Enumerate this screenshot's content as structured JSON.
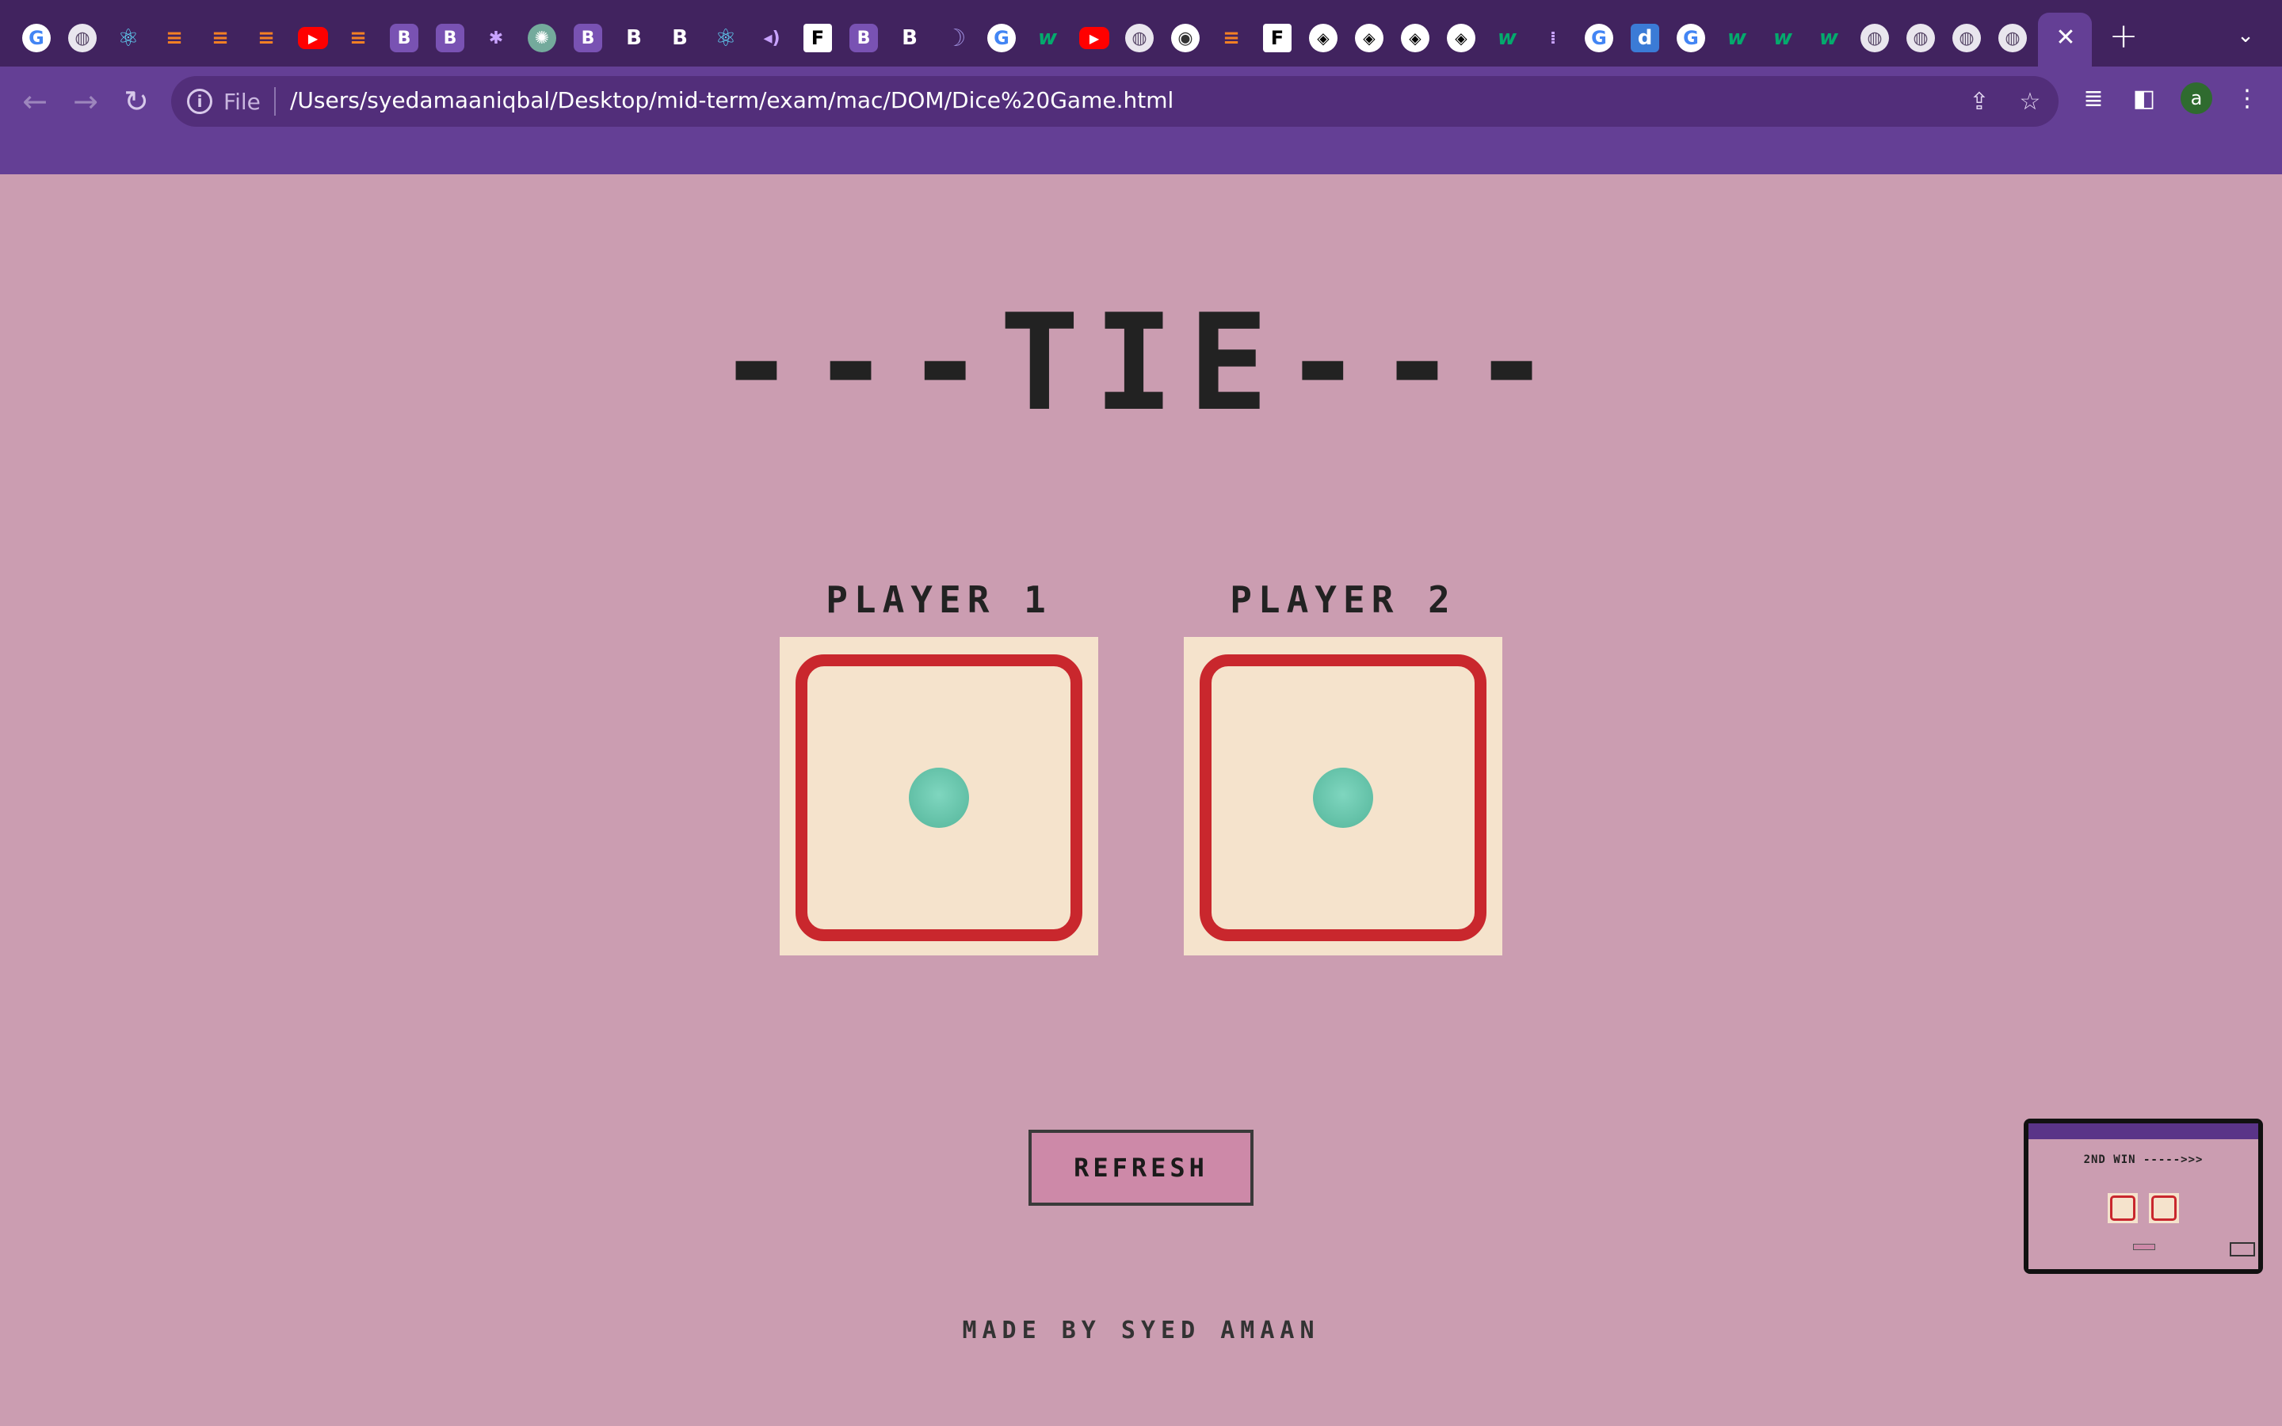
{
  "browser": {
    "tabs": [
      {
        "icon": "google-icon",
        "glyph": "G"
      },
      {
        "icon": "globe-icon",
        "glyph": "◍"
      },
      {
        "icon": "react-icon",
        "glyph": "⚛"
      },
      {
        "icon": "stackoverflow-icon",
        "glyph": "≡"
      },
      {
        "icon": "stackoverflow-icon",
        "glyph": "≡"
      },
      {
        "icon": "stackoverflow-icon",
        "glyph": "≡"
      },
      {
        "icon": "youtube-icon",
        "glyph": "▶"
      },
      {
        "icon": "stackoverflow-icon",
        "glyph": "≡"
      },
      {
        "icon": "behance-icon",
        "glyph": "B"
      },
      {
        "icon": "behance-icon",
        "glyph": "B"
      },
      {
        "icon": "misc-icon",
        "glyph": "✱"
      },
      {
        "icon": "chatgpt-icon",
        "glyph": "✺"
      },
      {
        "icon": "bootstrap-icon",
        "glyph": "B"
      },
      {
        "icon": "bootstrap-dark-icon",
        "glyph": "B"
      },
      {
        "icon": "bootstrap-dark-icon",
        "glyph": "B"
      },
      {
        "icon": "react-icon",
        "glyph": "⚛"
      },
      {
        "icon": "audio-icon",
        "glyph": "◂)"
      },
      {
        "icon": "frontendmentor-icon",
        "glyph": "F"
      },
      {
        "icon": "bootstrap-icon",
        "glyph": "B"
      },
      {
        "icon": "bootstrap-dark-icon",
        "glyph": "B"
      },
      {
        "icon": "moon-icon",
        "glyph": "☽"
      },
      {
        "icon": "google-icon",
        "glyph": "G"
      },
      {
        "icon": "w3schools-icon",
        "glyph": "w"
      },
      {
        "icon": "youtube-icon",
        "glyph": "▶"
      },
      {
        "icon": "globe-icon",
        "glyph": "◍"
      },
      {
        "icon": "chrome-icon",
        "glyph": "◉"
      },
      {
        "icon": "stackoverflow-icon",
        "glyph": "≡"
      },
      {
        "icon": "frontendmentor-icon",
        "glyph": "F"
      },
      {
        "icon": "codepen-icon",
        "glyph": "◈"
      },
      {
        "icon": "codepen-icon",
        "glyph": "◈"
      },
      {
        "icon": "codepen-icon",
        "glyph": "◈"
      },
      {
        "icon": "codepen-icon",
        "glyph": "◈"
      },
      {
        "icon": "w3schools-icon",
        "glyph": "w"
      },
      {
        "icon": "misc-icon",
        "glyph": "⁞"
      },
      {
        "icon": "google-icon",
        "glyph": "G"
      },
      {
        "icon": "dev-icon",
        "glyph": "d"
      },
      {
        "icon": "google-icon",
        "glyph": "G"
      },
      {
        "icon": "w3schools-icon",
        "glyph": "w"
      },
      {
        "icon": "w3schools-icon",
        "glyph": "w"
      },
      {
        "icon": "w3schools-icon",
        "glyph": "w"
      },
      {
        "icon": "globe-icon",
        "glyph": "◍"
      },
      {
        "icon": "globe-icon",
        "glyph": "◍"
      },
      {
        "icon": "globe-icon",
        "glyph": "◍"
      },
      {
        "icon": "globe-icon",
        "glyph": "◍"
      }
    ],
    "address_scheme": "File",
    "url": "/Users/syedamaaniqbal/Desktop/mid-term/exam/mac/DOM/Dice%20Game.html",
    "profile_initial": "a"
  },
  "page": {
    "headline": "---TIE---",
    "players": [
      {
        "label": "PLAYER 1",
        "die_value": 1
      },
      {
        "label": "PLAYER 2",
        "die_value": 1
      }
    ],
    "refresh_label": "REFRESH",
    "credit": "MADE BY SYED AMAAN"
  },
  "thumbnail": {
    "title": "2ND WIN ----->>>"
  },
  "colors": {
    "tabstrip": "#41235f",
    "toolbar": "#643f95",
    "page_bg": "#cb9db1",
    "die_bg": "#f5e3cc",
    "die_border": "#c9272d",
    "pip": "#6cc9ad",
    "button_bg": "#cd89a8"
  }
}
